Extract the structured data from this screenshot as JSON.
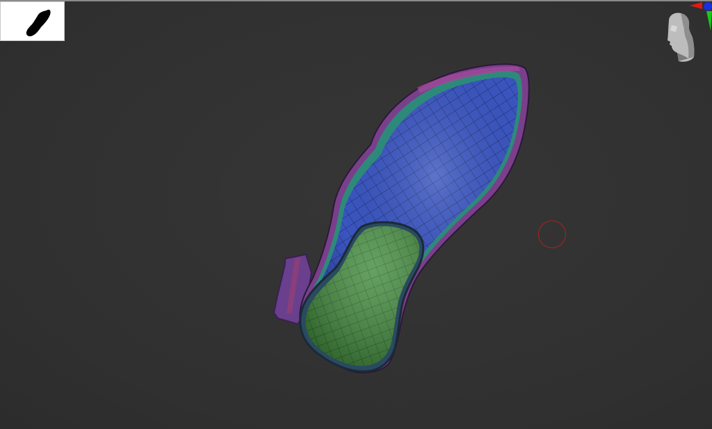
{
  "app": {
    "canvas_background": "#323232"
  },
  "thumbnail": {
    "icon": "shoe-silhouette-icon"
  },
  "navigation_gizmo": {
    "icon": "head-orientation-icon",
    "axis_colors": {
      "x": "#e01818",
      "y": "#18c818",
      "z": "#1830e0"
    }
  },
  "model": {
    "type": "shoe-mesh",
    "upper_color": "#3a55c0",
    "sole_color": "#3f8a3a",
    "rim_color": "#7a3f8a",
    "inner_band_color": "#2d8a7a"
  },
  "brush": {
    "cursor_color": "#b02020"
  }
}
